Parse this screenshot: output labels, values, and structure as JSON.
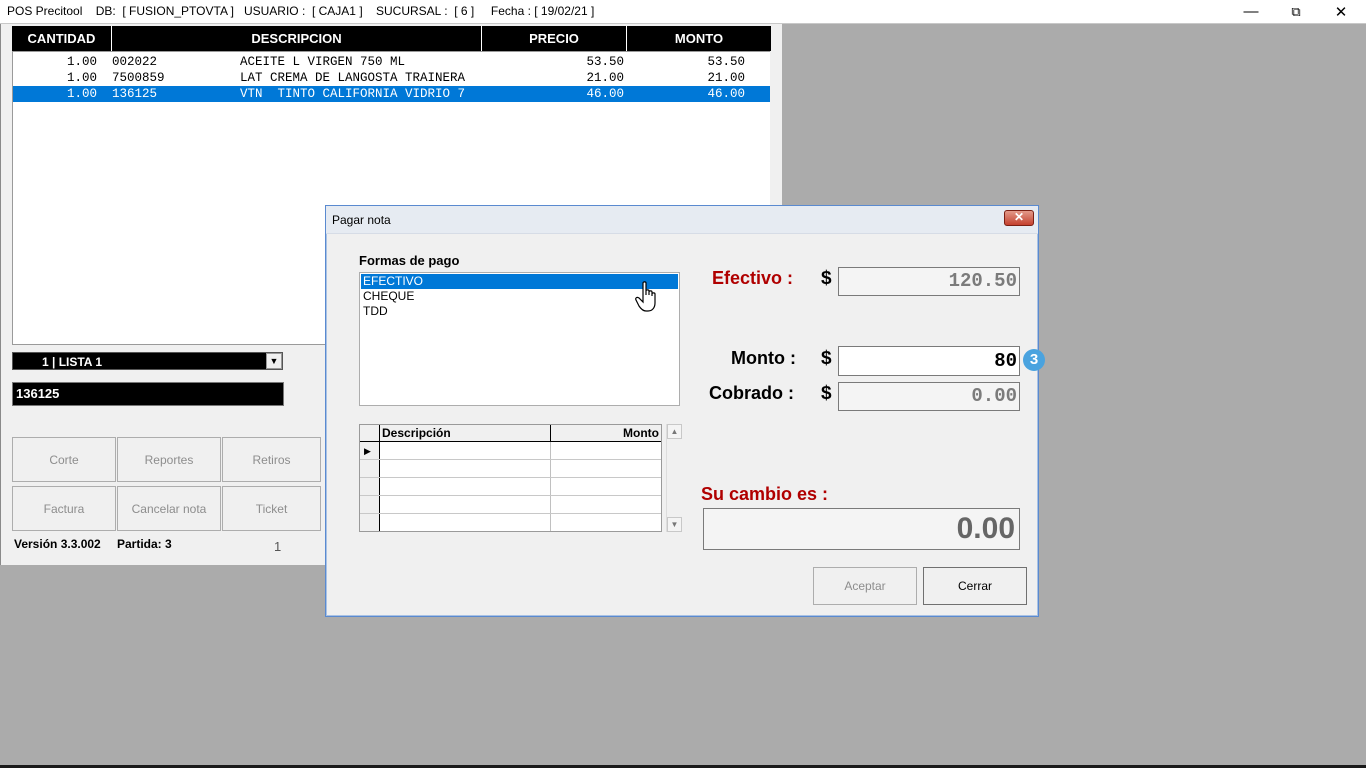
{
  "window": {
    "title": "POS Precitool    DB:  [ FUSION_PTOVTA ]   USUARIO :  [ CAJA1 ]    SUCURSAL :  [ 6 ]     Fecha : [ 19/02/21 ]",
    "minimize_icon": "minimize-icon",
    "restore_icon": "restore-icon",
    "close_icon": "close-icon"
  },
  "sale_grid": {
    "columns": [
      "CANTIDAD",
      "DESCRIPCION",
      "PRECIO",
      "MONTO"
    ],
    "rows": [
      {
        "cantidad": "1.00",
        "codigo": "002022",
        "descripcion": "ACEITE L VIRGEN 750 ML",
        "precio": "53.50",
        "monto": "53.50",
        "selected": false
      },
      {
        "cantidad": "1.00",
        "codigo": "7500859",
        "descripcion": "LAT CREMA DE LANGOSTA TRAINERA",
        "precio": "21.00",
        "monto": "21.00",
        "selected": false
      },
      {
        "cantidad": "1.00",
        "codigo": "136125",
        "descripcion": "VTN  TINTO CALIFORNIA VIDRIO 7",
        "precio": "46.00",
        "monto": "46.00",
        "selected": true
      }
    ]
  },
  "price_list": {
    "selected": "1  | LISTA 1"
  },
  "product_code": {
    "value": "136125"
  },
  "buttons": {
    "corte": "Corte",
    "reportes": "Reportes",
    "retiros": "Retiros",
    "factura": "Factura",
    "cancelar_nota": "Cancelar nota",
    "ticket": "Ticket"
  },
  "footer": {
    "version": "Versión 3.3.002",
    "partida": "Partida: 3",
    "count": "1"
  },
  "dialog": {
    "title": "Pagar nota",
    "formas_label": "Formas de pago",
    "formas": [
      "EFECTIVO",
      "CHEQUE",
      "TDD"
    ],
    "selected_forma": "EFECTIVO",
    "payments_grid": {
      "columns": [
        "Descripción",
        "Monto"
      ],
      "rows": 5
    },
    "efectivo_label": "Efectivo :",
    "efectivo_value": "120.50",
    "monto_label": "Monto :",
    "monto_value": "80",
    "cobrado_label": "Cobrado :",
    "cobrado_value": "0.00",
    "currency_symbol": "$",
    "cambio_label": "Su cambio es :",
    "cambio_value": "0.00",
    "aceptar": "Aceptar",
    "cerrar": "Cerrar",
    "badge": "3"
  },
  "colors": {
    "selection": "#0078d7",
    "label_red": "#b00000",
    "grid_header": "#000000"
  }
}
